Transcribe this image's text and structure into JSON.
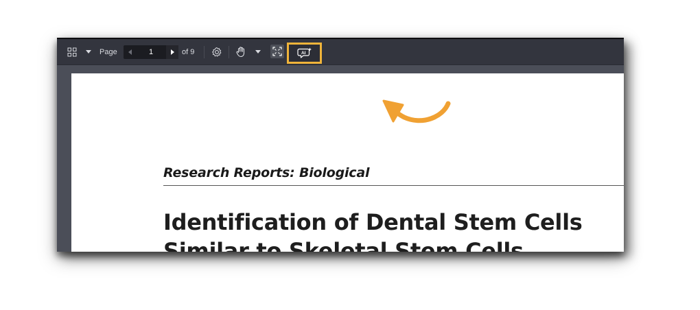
{
  "toolbar": {
    "page_label": "Page",
    "current_page": "1",
    "page_total": "of 9",
    "ai_button_label": "AI"
  },
  "document": {
    "section": "Research Reports: Biological",
    "title_line1": "Identification of Dental Stem Cells",
    "title_line2": "Similar to Skeletal Stem Cells"
  },
  "colors": {
    "highlight": "#f0b43a",
    "arrow": "#f0a133",
    "toolbar": "#33353e",
    "canvas": "#4b4e58"
  },
  "icons": [
    "thumbnail-grid-icon",
    "chevron-down-icon",
    "prev-page-icon",
    "next-page-icon",
    "gear-icon",
    "hand-pan-icon",
    "fit-page-icon",
    "ai-assistant-icon",
    "curved-arrow-icon"
  ]
}
